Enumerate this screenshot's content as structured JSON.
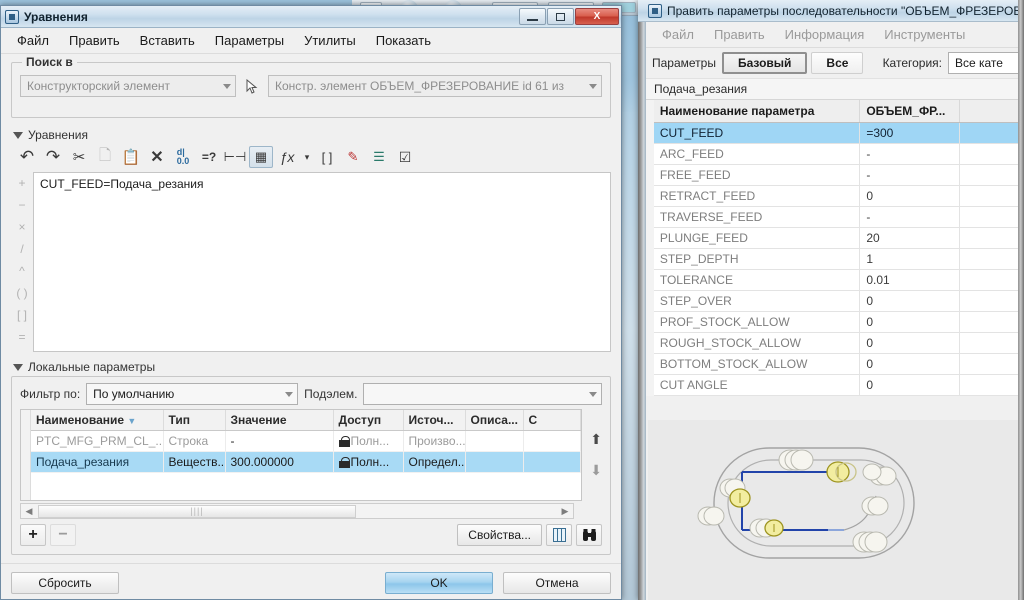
{
  "equations_window": {
    "title": "Уравнения",
    "window_buttons": {
      "minimize": "—",
      "maximize": "□",
      "close": "X"
    },
    "menu": [
      "Файл",
      "Править",
      "Вставить",
      "Параметры",
      "Утилиты",
      "Показать"
    ],
    "search_group": {
      "legend": "Поиск в",
      "scope_value": "Конструкторский элемент",
      "picker_icon": "cursor-arrow-icon",
      "target_value": "Констр. элемент ОБЪЕМ_ФРЕЗЕРОВАНИЕ id 61 из"
    },
    "equations_section": {
      "title": "Уравнения",
      "toolbar": [
        {
          "name": "undo-icon",
          "glyph": "↶"
        },
        {
          "name": "redo-icon",
          "glyph": "↷"
        },
        {
          "name": "cut-icon",
          "glyph": "✂"
        },
        {
          "name": "copy-icon",
          "glyph": "❐"
        },
        {
          "name": "paste-icon",
          "glyph": "Ὄb"
        },
        {
          "name": "delete-icon",
          "glyph": "✕"
        },
        {
          "name": "sort-numeric-icon",
          "glyph": "↕"
        },
        {
          "name": "verify-equals-icon",
          "glyph": "=?"
        },
        {
          "name": "dimension-icon",
          "glyph": "⊢⊣"
        },
        {
          "name": "switch-dimensions-icon",
          "glyph": "▦"
        },
        {
          "name": "function-icon",
          "glyph": "ƒx"
        },
        {
          "name": "function-dropdown-icon",
          "glyph": "▾"
        },
        {
          "name": "brackets-icon",
          "glyph": "[ ]"
        },
        {
          "name": "units-icon",
          "glyph": "⚠"
        },
        {
          "name": "layers-icon",
          "glyph": "☰"
        },
        {
          "name": "check-icon",
          "glyph": "☑"
        }
      ],
      "operators": [
        "+",
        "−",
        "×",
        "/",
        "^",
        "( )",
        "[ ]",
        "="
      ],
      "equation_text": "CUT_FEED=Подача_резания"
    },
    "local_params_section": {
      "title": "Локальные параметры",
      "filter_label": "Фильтр по:",
      "filter_value": "По умолчанию",
      "subitem_label": "Подэлем.",
      "subitem_value": "",
      "columns": [
        "Наименование",
        "Тип",
        "Значение",
        "Доступ",
        "Источ...",
        "Описа...",
        "С"
      ],
      "sort_indicator": "▼",
      "rows": [
        {
          "name": "PTC_MFG_PRM_CL_...",
          "type": "Строка",
          "value": "-",
          "access": "Полн...",
          "source": "Произво...",
          "description": "",
          "extra": "",
          "selected": false
        },
        {
          "name": "Подача_резания",
          "type": "Веществ...",
          "value": "300.000000",
          "access": "Полн...",
          "source": "Определ...",
          "description": "",
          "extra": "",
          "selected": true
        }
      ],
      "scroll_up_icon": "arrow-up-icon",
      "scroll_down_icon": "arrow-down-icon",
      "add_button": "+",
      "remove_button": "−",
      "properties_button": "Свойства...",
      "columns_button_icon": "columns-icon",
      "find_button_icon": "binoculars-icon"
    },
    "footer": {
      "reset": "Сбросить",
      "ok": "OK",
      "cancel": "Отмена"
    }
  },
  "sequence_window": {
    "title": "Править параметры последовательности \"ОБЪЕМ_ФРЕЗЕРОВАНИЕ\"",
    "menu": [
      "Файл",
      "Править",
      "Информация",
      "Инструменты"
    ],
    "tabs_label": "Параметры",
    "tabs": [
      {
        "label": "Базовый",
        "active": true
      },
      {
        "label": "Все",
        "active": false
      }
    ],
    "category_label": "Категория:",
    "category_value": "Все кате",
    "sequence_name": "Подача_резания",
    "table": {
      "columns": [
        "Наименование параметра",
        "ОБЪЕМ_ФР..."
      ],
      "rows": [
        {
          "name": "CUT_FEED",
          "value": "=300",
          "selected": true
        },
        {
          "name": "ARC_FEED",
          "value": "-",
          "selected": false
        },
        {
          "name": "FREE_FEED",
          "value": "-",
          "selected": false
        },
        {
          "name": "RETRACT_FEED",
          "value": "0",
          "selected": false
        },
        {
          "name": "TRAVERSE_FEED",
          "value": "-",
          "selected": false
        },
        {
          "name": "PLUNGE_FEED",
          "value": "20",
          "selected": false
        },
        {
          "name": "STEP_DEPTH",
          "value": "1",
          "selected": false
        },
        {
          "name": "TOLERANCE",
          "value": "0.01",
          "selected": false
        },
        {
          "name": "STEP_OVER",
          "value": "0",
          "selected": false
        },
        {
          "name": "PROF_STOCK_ALLOW",
          "value": "0",
          "selected": false
        },
        {
          "name": "ROUGH_STOCK_ALLOW",
          "value": "0",
          "selected": false
        },
        {
          "name": "BOTTOM_STOCK_ALLOW",
          "value": "0",
          "selected": false
        },
        {
          "name": "CUT ANGLE",
          "value": "0",
          "selected": false
        }
      ]
    },
    "graphics_area": {
      "name": "toolpath-preview",
      "path_color": "#2244aa",
      "tool_color": "#f0e68c",
      "outline_color": "#9a9a9a"
    }
  },
  "colors": {
    "selection_blue": "#a8daf5",
    "primary_button": "#a7d4f0",
    "window_bg": "#f0f0f0",
    "close_red": "#c0392b"
  }
}
